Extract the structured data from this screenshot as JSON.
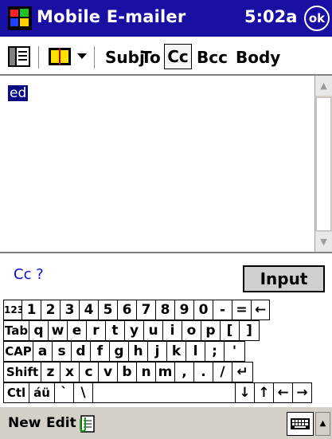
{
  "titlebar": {
    "title": "Mobile E-mailer",
    "clock": "5:02a",
    "ok_label": "ok"
  },
  "toolbar": {
    "labels": [
      "Subj",
      "To",
      "Cc",
      "Bcc",
      "Body"
    ],
    "selected": "Cc"
  },
  "editor": {
    "text": "ed"
  },
  "status": {
    "label": "Cc ?",
    "input_button": "Input"
  },
  "keyboard": {
    "row1": [
      "123",
      "1",
      "2",
      "3",
      "4",
      "5",
      "6",
      "7",
      "8",
      "9",
      "0",
      "-",
      "=",
      "←"
    ],
    "row2": [
      "Tab",
      "q",
      "w",
      "e",
      "r",
      "t",
      "y",
      "u",
      "i",
      "o",
      "p",
      "[",
      "]"
    ],
    "row3": [
      "CAP",
      "a",
      "s",
      "d",
      "f",
      "g",
      "h",
      "j",
      "k",
      "l",
      ";",
      "'"
    ],
    "row4": [
      "Shift",
      "z",
      "x",
      "c",
      "v",
      "b",
      "n",
      "m",
      ",",
      ".",
      "/",
      "↵"
    ],
    "row5": [
      "Ctl",
      "áü",
      "`",
      "\\",
      "",
      "↓",
      "↑",
      "←",
      "→"
    ]
  },
  "cmdbar": {
    "new": "New",
    "edit": "Edit"
  },
  "colors": {
    "titlebar": "#1a0fa3",
    "selection": "#0a0a84",
    "status_text": "#0a0ad0",
    "cmdbar": "#d4d0c8"
  },
  "icons": [
    "windows-flag-icon",
    "ok-button",
    "sidebar-view-icon",
    "address-book-icon",
    "dropdown-arrow-icon",
    "attachment-icon",
    "keyboard-icon"
  ]
}
